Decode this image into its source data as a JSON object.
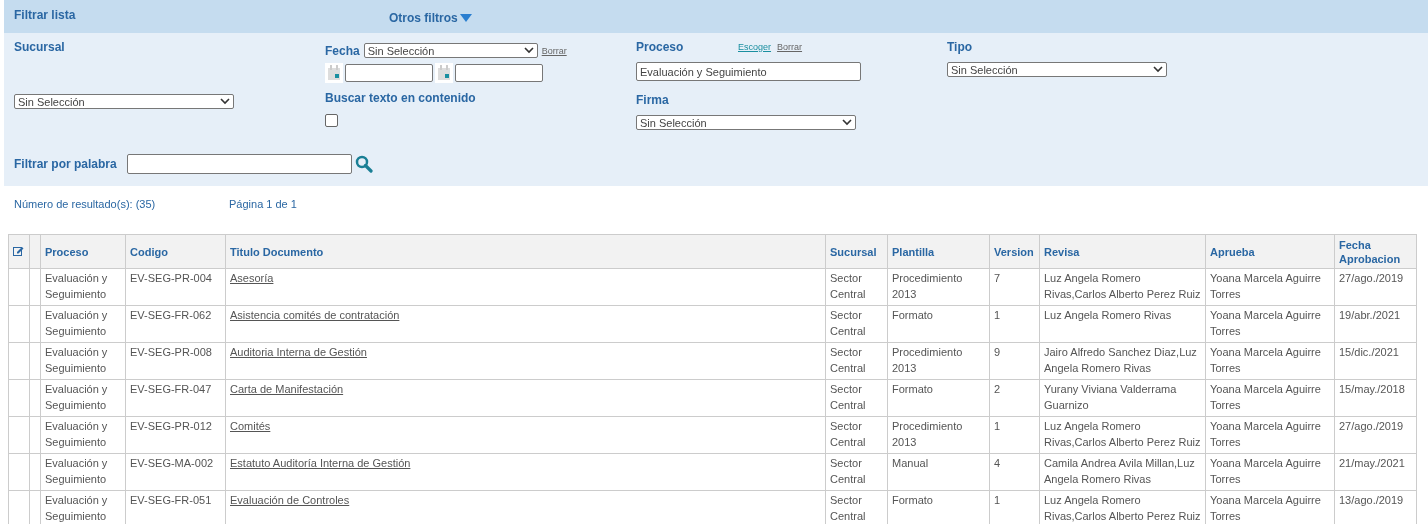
{
  "filter_panel": {
    "title": "Filtrar lista",
    "other_filters": "Otros filtros",
    "sucursal": {
      "label": "Sucursal",
      "value": "Sin Selección"
    },
    "fecha": {
      "label": "Fecha",
      "value": "Sin Selección",
      "clear": "Borrar"
    },
    "proceso": {
      "label": "Proceso",
      "choose": "Escoger",
      "clear": "Borrar",
      "value": "Evaluación y Seguimiento"
    },
    "tipo": {
      "label": "Tipo",
      "value": "Sin Selección"
    },
    "buscar": {
      "label": "Buscar texto en contenido",
      "checked": false
    },
    "firma": {
      "label": "Firma",
      "value": "Sin Selección"
    },
    "word_filter": {
      "label": "Filtrar por palabra"
    }
  },
  "results": {
    "count": "Número de resultado(s): (35)",
    "page": "Página 1 de 1"
  },
  "table": {
    "columns": [
      "Proceso",
      "Codigo",
      "Titulo Documento",
      "Sucursal",
      "Plantilla",
      "Version",
      "Revisa",
      "Aprueba",
      "Fecha Aprobacion"
    ],
    "rows": [
      {
        "proceso": "Evaluación y Seguimiento",
        "codigo": "EV-SEG-PR-004",
        "titulo": "Asesoría",
        "sucursal": "Sector Central",
        "plantilla": "Procedimiento 2013",
        "version": "7",
        "revisa": "Luz Angela Romero Rivas,Carlos Alberto Perez Ruiz",
        "aprueba": "Yoana Marcela Aguirre Torres",
        "fecha": "27/ago./2019"
      },
      {
        "proceso": "Evaluación y Seguimiento",
        "codigo": "EV-SEG-FR-062",
        "titulo": "Asistencia comités de contratación",
        "sucursal": "Sector Central",
        "plantilla": "Formato",
        "version": "1",
        "revisa": "Luz Angela Romero Rivas",
        "aprueba": "Yoana Marcela Aguirre Torres",
        "fecha": "19/abr./2021"
      },
      {
        "proceso": "Evaluación y Seguimiento",
        "codigo": "EV-SEG-PR-008",
        "titulo": "Auditoria Interna de Gestión",
        "sucursal": "Sector Central",
        "plantilla": "Procedimiento 2013",
        "version": "9",
        "revisa": "Jairo Alfredo Sanchez Diaz,Luz Angela Romero Rivas",
        "aprueba": "Yoana Marcela Aguirre Torres",
        "fecha": "15/dic./2021"
      },
      {
        "proceso": "Evaluación y Seguimiento",
        "codigo": "EV-SEG-FR-047",
        "titulo": "Carta de Manifestación",
        "sucursal": "Sector Central",
        "plantilla": "Formato",
        "version": "2",
        "revisa": "Yurany Viviana Valderrama Guarnizo",
        "aprueba": "Yoana Marcela Aguirre Torres",
        "fecha": "15/may./2018"
      },
      {
        "proceso": "Evaluación y Seguimiento",
        "codigo": "EV-SEG-PR-012",
        "titulo": "Comités",
        "sucursal": "Sector Central",
        "plantilla": "Procedimiento 2013",
        "version": "1",
        "revisa": "Luz Angela Romero Rivas,Carlos Alberto Perez Ruiz",
        "aprueba": "Yoana Marcela Aguirre Torres",
        "fecha": "27/ago./2019"
      },
      {
        "proceso": "Evaluación y Seguimiento",
        "codigo": "EV-SEG-MA-002",
        "titulo": "Estatuto Auditoría Interna de Gestión",
        "sucursal": "Sector Central",
        "plantilla": "Manual",
        "version": "4",
        "revisa": "Camila Andrea Avila Millan,Luz Angela Romero Rivas",
        "aprueba": "Yoana Marcela Aguirre Torres",
        "fecha": "21/may./2021"
      },
      {
        "proceso": "Evaluación y Seguimiento",
        "codigo": "EV-SEG-FR-051",
        "titulo": "Evaluación de Controles",
        "sucursal": "Sector Central",
        "plantilla": "Formato",
        "version": "1",
        "revisa": "Luz Angela Romero Rivas,Carlos Alberto Perez Ruiz",
        "aprueba": "Yoana Marcela Aguirre Torres",
        "fecha": "13/ago./2019"
      }
    ]
  }
}
